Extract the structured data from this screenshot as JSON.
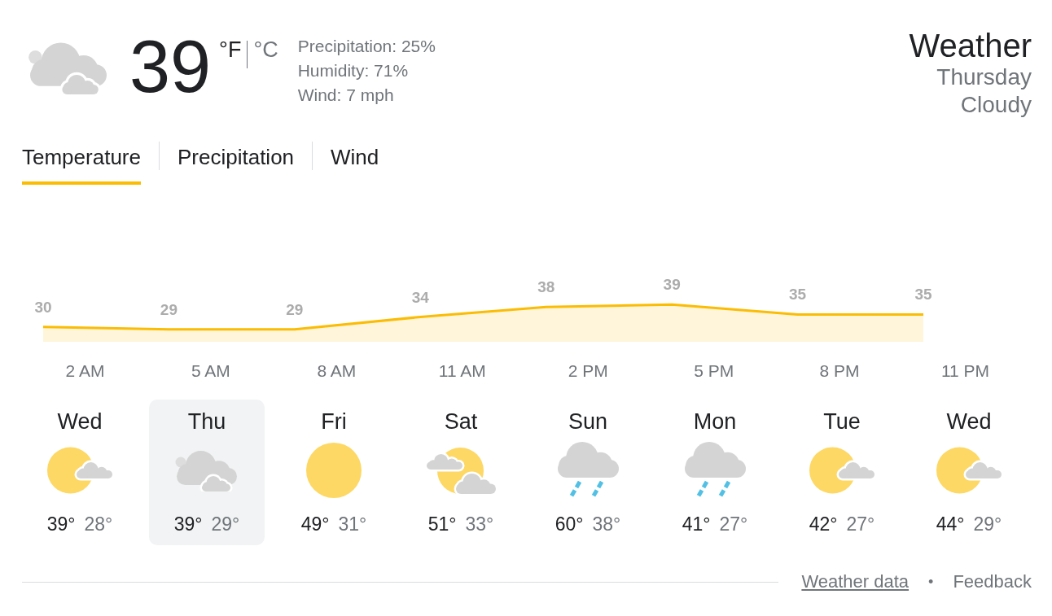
{
  "current": {
    "temperature": "39",
    "units": [
      {
        "label": "°F",
        "selected": true
      },
      {
        "label": "°C",
        "selected": false
      }
    ],
    "details": [
      "Precipitation: 25%",
      "Humidity: 71%",
      "Wind: 7 mph"
    ]
  },
  "summary": {
    "title": "Weather",
    "day": "Thursday",
    "condition": "Cloudy"
  },
  "tabs": [
    {
      "label": "Temperature",
      "selected": true
    },
    {
      "label": "Precipitation",
      "selected": false
    },
    {
      "label": "Wind",
      "selected": false
    }
  ],
  "chart": {
    "chart_data": {
      "type": "area",
      "categories": [
        null,
        "2 AM",
        null,
        null,
        "5 AM",
        null,
        null,
        "8 AM",
        null,
        null,
        "11 AM",
        null,
        null,
        "2 PM",
        null,
        null,
        "5 PM",
        null,
        null,
        "8 PM",
        null,
        null,
        "11 PM",
        null
      ],
      "series": [
        {
          "color": "#fbbc04",
          "values": [
            30,
            null,
            null,
            29,
            null,
            null,
            29,
            null,
            null,
            34,
            null,
            null,
            38,
            null,
            null,
            39,
            null,
            null,
            35,
            null,
            null,
            35,
            null,
            null
          ]
        }
      ],
      "data_labels": true
    }
  },
  "days": [
    {
      "name": "Wed",
      "kind": "sun_cloud",
      "high": "39°",
      "low": "28°",
      "selected": false
    },
    {
      "name": "Thu",
      "kind": "clouds",
      "high": "39°",
      "low": "29°",
      "selected": true
    },
    {
      "name": "Fri",
      "kind": "sun",
      "high": "49°",
      "low": "31°",
      "selected": false
    },
    {
      "name": "Sat",
      "kind": "sun_clouds",
      "high": "51°",
      "low": "33°",
      "selected": false
    },
    {
      "name": "Sun",
      "kind": "rain",
      "high": "60°",
      "low": "38°",
      "selected": false
    },
    {
      "name": "Mon",
      "kind": "rain",
      "high": "41°",
      "low": "27°",
      "selected": false
    },
    {
      "name": "Tue",
      "kind": "sun_cloud",
      "high": "42°",
      "low": "27°",
      "selected": false
    },
    {
      "name": "Wed",
      "kind": "sun_cloud",
      "high": "44°",
      "low": "29°",
      "selected": false
    }
  ],
  "footer": {
    "links": [
      {
        "label": "Weather data",
        "underlined": true
      },
      {
        "label": "Feedback",
        "underlined": false
      }
    ],
    "separator": "•"
  }
}
